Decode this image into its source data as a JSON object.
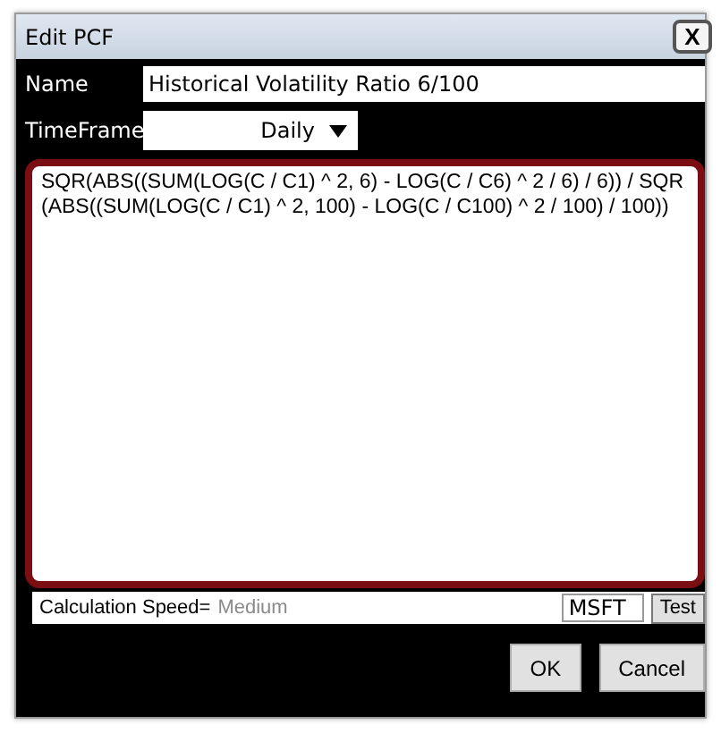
{
  "window": {
    "title": "Edit PCF",
    "close_label": "X"
  },
  "name_field": {
    "label": "Name",
    "value": "Historical Volatility Ratio 6/100"
  },
  "timeframe": {
    "label": "TimeFrame",
    "value": "Daily"
  },
  "formula": "SQR(ABS((SUM(LOG(C / C1) ^ 2, 6) - LOG(C / C6) ^ 2 / 6) / 6)) / SQR (ABS((SUM(LOG(C / C1) ^ 2, 100) - LOG(C / C100) ^ 2 / 100) / 100))",
  "status": {
    "label": "Calculation Speed=",
    "value": "Medium",
    "symbol": "MSFT",
    "test_button": "Test"
  },
  "buttons": [
    "OK",
    "Cancel"
  ]
}
